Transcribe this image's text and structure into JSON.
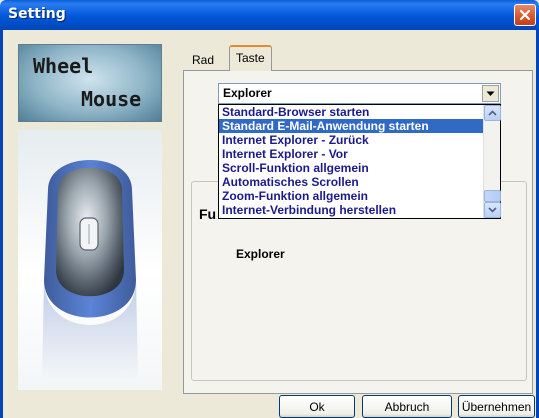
{
  "window": {
    "title": "Setting",
    "close_icon": "close-icon"
  },
  "logo": {
    "line1": "Wheel",
    "line2": "Mouse"
  },
  "tabs": [
    {
      "label": "Rad",
      "active": false
    },
    {
      "label": "Taste",
      "active": true
    }
  ],
  "combo": {
    "value": "Explorer"
  },
  "dropdown": {
    "items": [
      "Standard-Browser starten",
      "Standard E-Mail-Anwendung starten",
      "Internet Explorer - Zurück",
      "Internet Explorer - Vor",
      "Scroll-Funktion allgemein",
      "Automatisches Scrollen",
      "Zoom-Funktion allgemein",
      "Internet-Verbindung herstellen"
    ],
    "selected_index": 1
  },
  "group": {
    "label_partial": "Fu",
    "explorer_text": "Explorer"
  },
  "buttons": {
    "ok": "Ok",
    "cancel": "Abbruch",
    "apply": "Übernehmen"
  },
  "colors": {
    "titlebar": "#0057d9",
    "selection": "#316ac5",
    "item_text": "#1a1a8c",
    "active_tab_accent": "#e68b2c"
  }
}
